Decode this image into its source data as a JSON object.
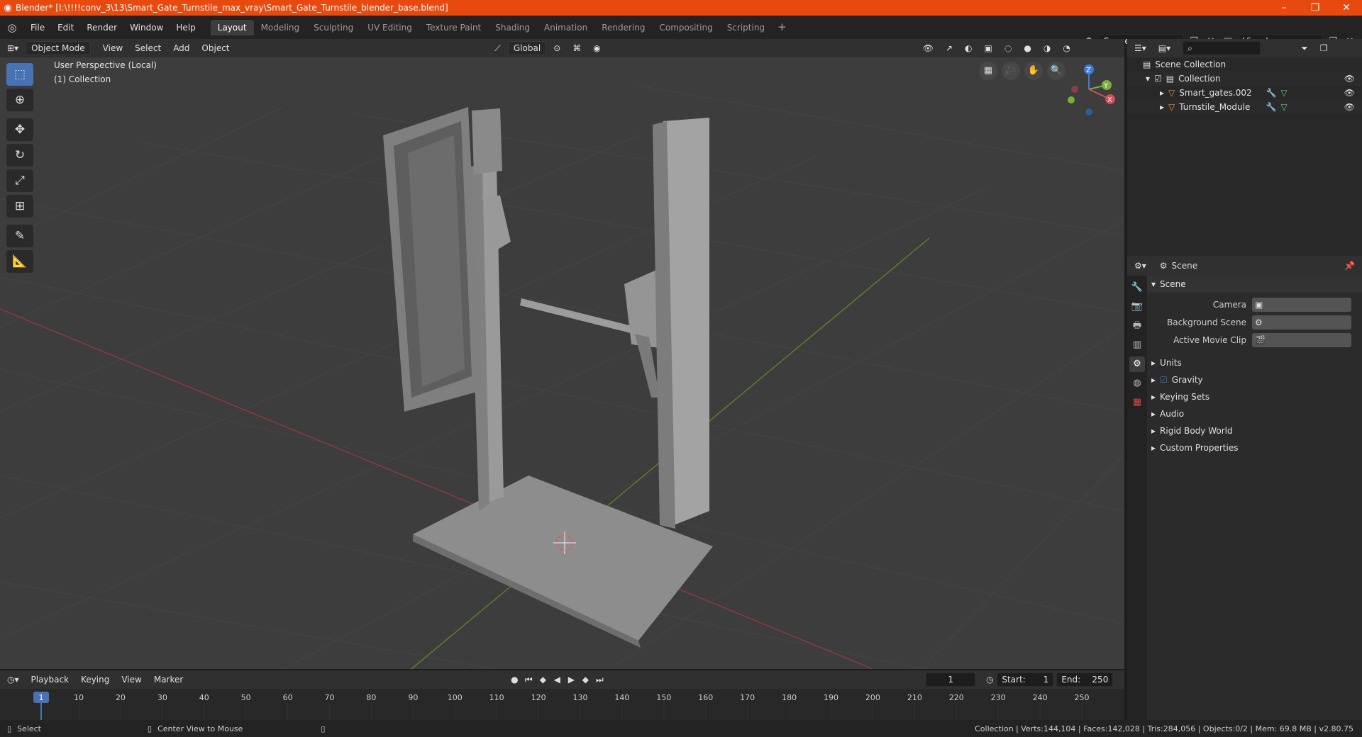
{
  "window": {
    "title": "Blender* [I:\\!!!!conv_3\\13\\Smart_Gate_Turnstile_max_vray\\Smart_Gate_Turnstile_blender_base.blend]"
  },
  "menu": [
    "File",
    "Edit",
    "Render",
    "Window",
    "Help"
  ],
  "workspaces": [
    "Layout",
    "Modeling",
    "Sculpting",
    "UV Editing",
    "Texture Paint",
    "Shading",
    "Animation",
    "Rendering",
    "Compositing",
    "Scripting"
  ],
  "active_workspace": "Layout",
  "scene_name": "Scene",
  "view_layer": "View Layer",
  "viewport_header": {
    "mode": "Object Mode",
    "menus": [
      "View",
      "Select",
      "Add",
      "Object"
    ],
    "transform_orientation": "Global"
  },
  "viewport": {
    "perspective_label": "User Perspective (Local)",
    "collection_label": "(1) Collection",
    "gizmo_axes": [
      "X",
      "Y",
      "Z"
    ]
  },
  "outliner": {
    "root": "Scene Collection",
    "collection": "Collection",
    "objects": [
      "Smart_gates.002",
      "Turnstile_Module"
    ]
  },
  "properties": {
    "header": "Scene",
    "panel": "Scene",
    "fields": [
      {
        "label": "Camera",
        "value": ""
      },
      {
        "label": "Background Scene",
        "value": ""
      },
      {
        "label": "Active Movie Clip",
        "value": ""
      }
    ],
    "subpanels": [
      "Units",
      "Gravity",
      "Keying Sets",
      "Audio",
      "Rigid Body World",
      "Custom Properties"
    ],
    "gravity_checked": true
  },
  "timeline": {
    "menus": [
      "Playback",
      "Keying",
      "View",
      "Marker"
    ],
    "current_frame": "1",
    "start_label": "Start:",
    "start": "1",
    "end_label": "End:",
    "end": "250",
    "ruler": [
      "1",
      "10",
      "20",
      "30",
      "40",
      "50",
      "60",
      "70",
      "80",
      "90",
      "100",
      "110",
      "120",
      "130",
      "140",
      "150",
      "160",
      "170",
      "180",
      "190",
      "200",
      "210",
      "220",
      "230",
      "240",
      "250"
    ]
  },
  "statusbar": {
    "select": "Select",
    "center_view": "Center View to Mouse",
    "stats": "Collection | Verts:144,104 | Faces:142,028 | Tris:284,056 | Objects:0/2 | Mem: 69.8 MB | v2.80.75"
  },
  "colors": {
    "titlebar": "#e8490f",
    "accent": "#4772b3",
    "x_axis": "#d64d55",
    "y_axis": "#7aaf3b",
    "z_axis": "#3d7cd6"
  }
}
